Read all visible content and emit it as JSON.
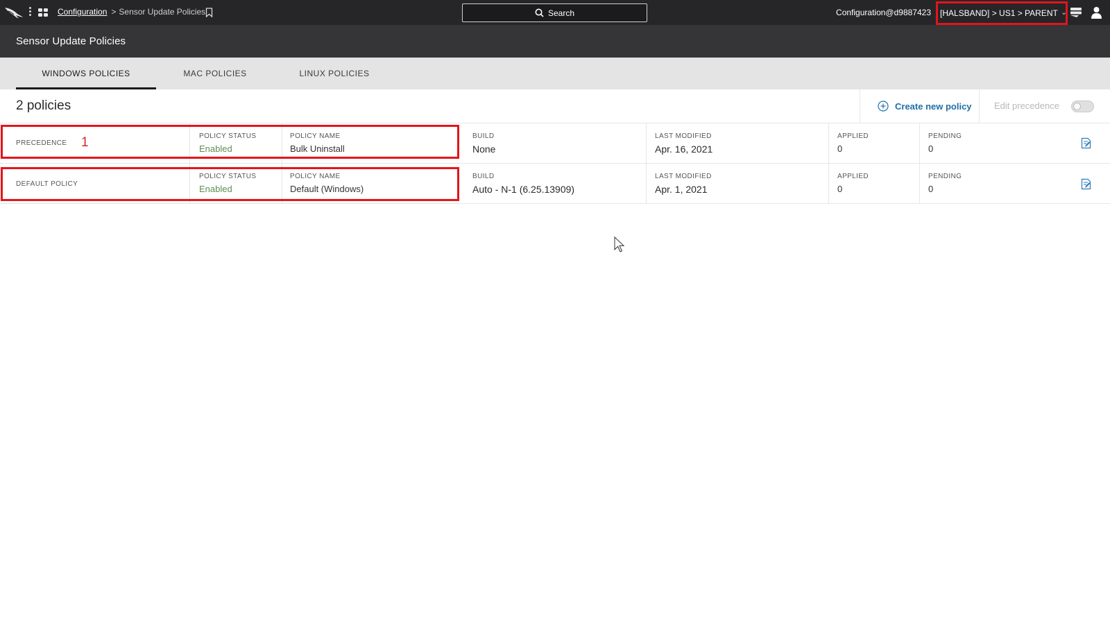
{
  "topbar": {
    "breadcrumb_link": "Configuration",
    "breadcrumb_current": "Sensor Update Policies",
    "search_label": "Search",
    "user_email": "Configuration@d9887423",
    "tenant_path": "[HALSBAND] > US1 > PARENT"
  },
  "page": {
    "title": "Sensor Update Policies"
  },
  "tabs": [
    {
      "label": "WINDOWS POLICIES",
      "active": true
    },
    {
      "label": "MAC POLICIES",
      "active": false
    },
    {
      "label": "LINUX POLICIES",
      "active": false
    }
  ],
  "toolbar": {
    "count_label": "2 policies",
    "create_label": "Create new policy",
    "edit_precedence_label": "Edit precedence"
  },
  "columns": {
    "status": "POLICY STATUS",
    "name": "POLICY NAME",
    "build": "BUILD",
    "modified": "LAST MODIFIED",
    "applied": "APPLIED",
    "pending": "PENDING"
  },
  "policies": [
    {
      "precedence_label": "PRECEDENCE",
      "precedence": "1",
      "status": "Enabled",
      "name": "Bulk Uninstall",
      "build": "None",
      "modified": "Apr. 16, 2021",
      "applied": "0",
      "pending": "0"
    },
    {
      "precedence_label": "DEFAULT POLICY",
      "precedence": "",
      "status": "Enabled",
      "name": "Default (Windows)",
      "build": "Auto - N-1 (6.25.13909)",
      "modified": "Apr. 1, 2021",
      "applied": "0",
      "pending": "0"
    }
  ],
  "colors": {
    "topbar_bg": "#262629",
    "header_bg": "#353538",
    "accent_blue": "#1e6fa8",
    "status_green": "#5e8f52",
    "highlight_red": "#e3151a"
  },
  "icons": [
    "falcon-logo-icon",
    "kebab-icon",
    "apps-icon",
    "bookmark-icon",
    "search-icon",
    "chevron-down-icon",
    "notification-icon",
    "user-icon",
    "plus-circle-icon",
    "edit-policy-icon",
    "cursor-icon"
  ]
}
